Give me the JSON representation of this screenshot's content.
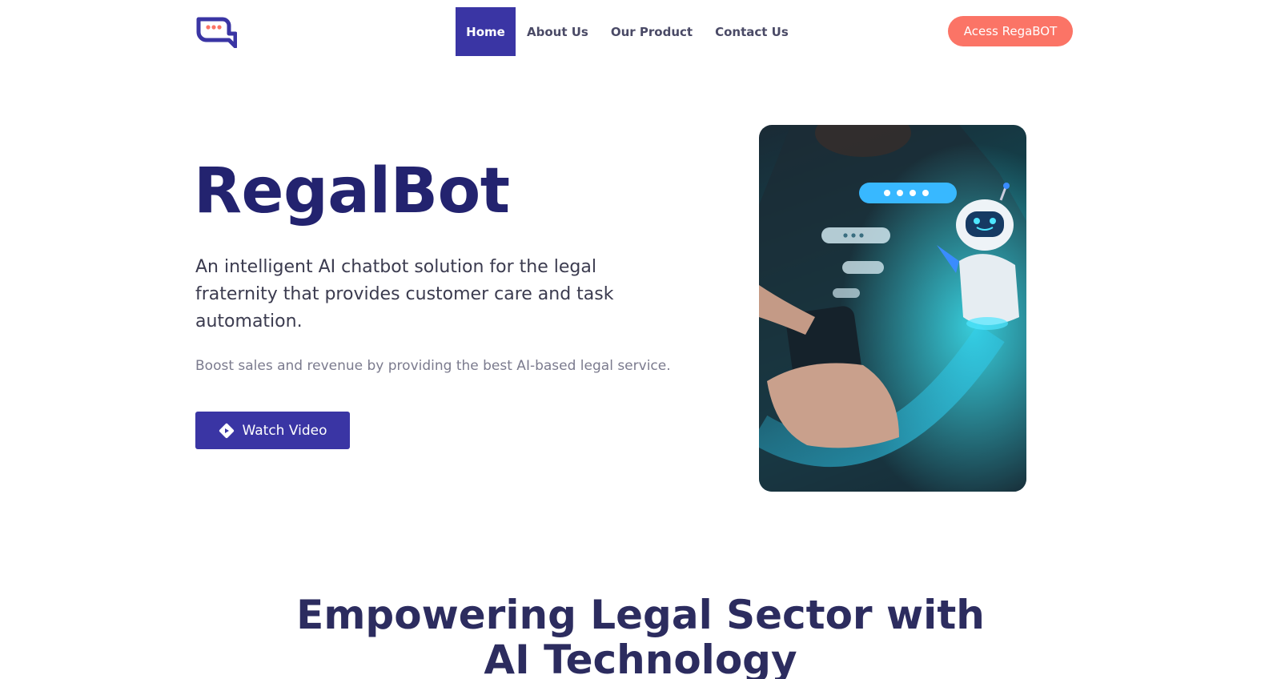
{
  "brand": {
    "logo_icon": "chat-bubble-logo-icon",
    "accent": "#3a35a4",
    "cta_color": "#fb7466"
  },
  "nav": {
    "items": [
      {
        "label": "Home",
        "active": true
      },
      {
        "label": "About Us",
        "active": false
      },
      {
        "label": "Our Product",
        "active": false
      },
      {
        "label": "Contact Us",
        "active": false
      }
    ],
    "cta_label": "Acess RegaBOT"
  },
  "hero": {
    "title": "RegalBot",
    "subtitle": "An intelligent AI chatbot solution for the legal fraternity that provides customer care and task automation.",
    "note": "Boost sales and revenue by providing the best AI-based legal service.",
    "button_label": "Watch Video",
    "button_icon": "play-diamond-icon",
    "image_icon": "chatbot-phone-illustration"
  },
  "section": {
    "title_line1": "Empowering Legal Sector with",
    "title_line2": "AI Technology"
  }
}
